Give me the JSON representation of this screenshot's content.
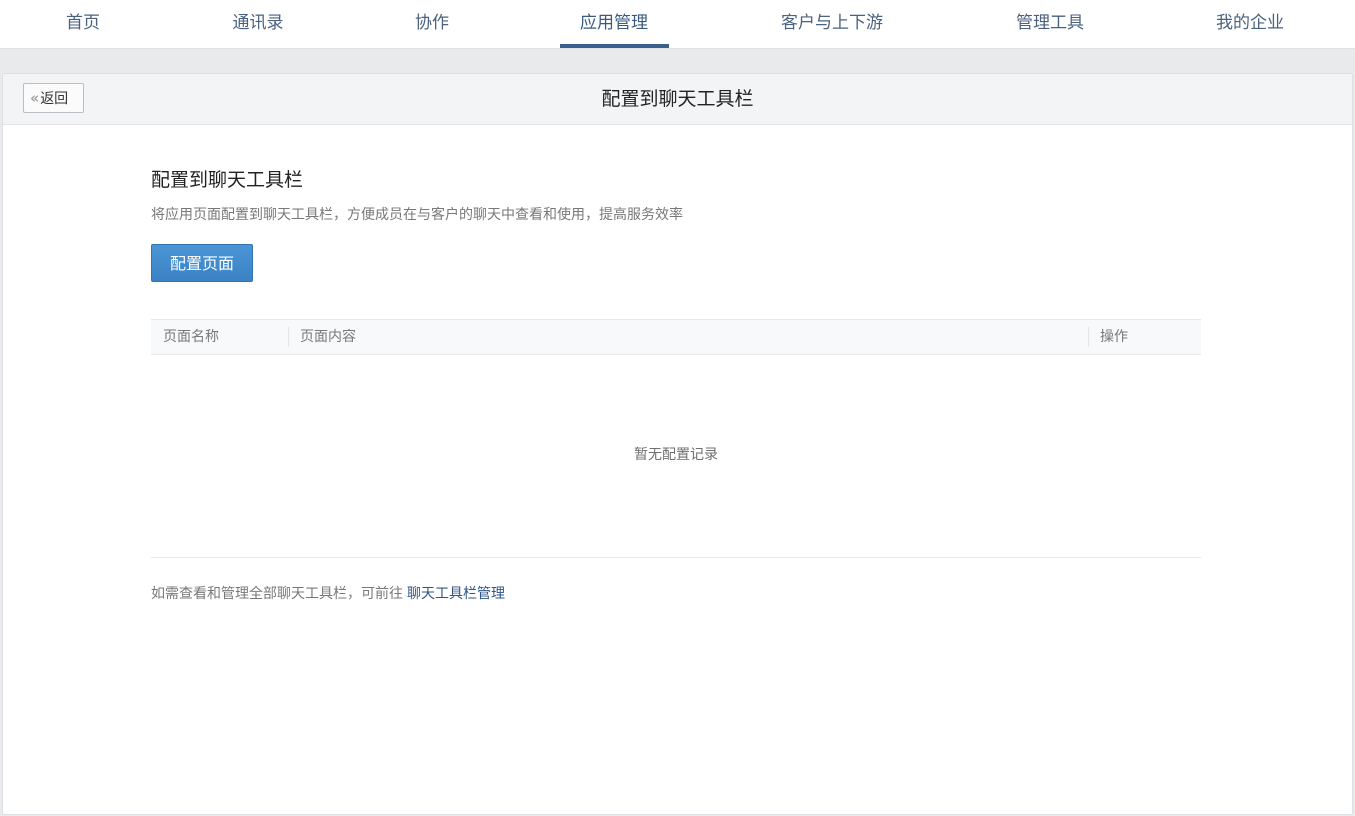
{
  "nav": {
    "items": [
      {
        "label": "首页"
      },
      {
        "label": "通讯录"
      },
      {
        "label": "协作"
      },
      {
        "label": "应用管理"
      },
      {
        "label": "客户与上下游"
      },
      {
        "label": "管理工具"
      },
      {
        "label": "我的企业"
      }
    ],
    "active_index": 3
  },
  "header": {
    "back_label": "返回",
    "title": "配置到聊天工具栏"
  },
  "section": {
    "title": "配置到聊天工具栏",
    "description": "将应用页面配置到聊天工具栏，方便成员在与客户的聊天中查看和使用，提高服务效率",
    "configure_button": "配置页面"
  },
  "table": {
    "columns": [
      "页面名称",
      "页面内容",
      "操作"
    ],
    "empty_text": "暂无配置记录"
  },
  "footer": {
    "note": "如需查看和管理全部聊天工具栏，可前往",
    "link_label": "聊天工具栏管理"
  },
  "colors": {
    "nav_text": "#4a6280",
    "nav_active_underline": "#3a5f8f",
    "primary_button": "#3a82c4",
    "link": "#2f5585"
  }
}
